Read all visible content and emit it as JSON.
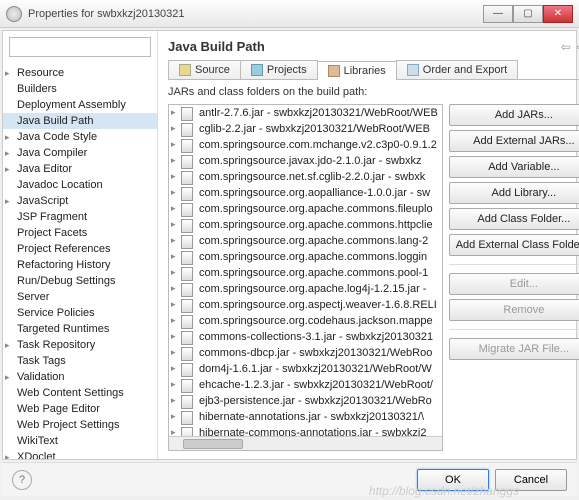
{
  "window": {
    "title": "Properties for swbxkzj20130321"
  },
  "sidebar": {
    "filter_placeholder": "",
    "items": [
      {
        "label": "Resource",
        "expandable": true
      },
      {
        "label": "Builders"
      },
      {
        "label": "Deployment Assembly"
      },
      {
        "label": "Java Build Path",
        "selected": true
      },
      {
        "label": "Java Code Style",
        "expandable": true
      },
      {
        "label": "Java Compiler",
        "expandable": true
      },
      {
        "label": "Java Editor",
        "expandable": true
      },
      {
        "label": "Javadoc Location"
      },
      {
        "label": "JavaScript",
        "expandable": true
      },
      {
        "label": "JSP Fragment"
      },
      {
        "label": "Project Facets"
      },
      {
        "label": "Project References"
      },
      {
        "label": "Refactoring History"
      },
      {
        "label": "Run/Debug Settings"
      },
      {
        "label": "Server"
      },
      {
        "label": "Service Policies"
      },
      {
        "label": "Targeted Runtimes"
      },
      {
        "label": "Task Repository",
        "expandable": true
      },
      {
        "label": "Task Tags"
      },
      {
        "label": "Validation",
        "expandable": true
      },
      {
        "label": "Web Content Settings"
      },
      {
        "label": "Web Page Editor"
      },
      {
        "label": "Web Project Settings"
      },
      {
        "label": "WikiText"
      },
      {
        "label": "XDoclet",
        "expandable": true
      }
    ]
  },
  "main": {
    "title": "Java Build Path",
    "tabs": [
      {
        "label": "Source"
      },
      {
        "label": "Projects"
      },
      {
        "label": "Libraries",
        "active": true
      },
      {
        "label": "Order and Export"
      }
    ],
    "description": "JARs and class folders on the build path:",
    "jars": [
      "antlr-2.7.6.jar - swbxkzj20130321/WebRoot/WEB",
      "cglib-2.2.jar - swbxkzj20130321/WebRoot/WEB",
      "com.springsource.com.mchange.v2.c3p0-0.9.1.2",
      "com.springsource.javax.jdo-2.1.0.jar - swbxkz",
      "com.springsource.net.sf.cglib-2.2.0.jar - swbxk",
      "com.springsource.org.aopalliance-1.0.0.jar - sw",
      "com.springsource.org.apache.commons.fileuplo",
      "com.springsource.org.apache.commons.httpclie",
      "com.springsource.org.apache.commons.lang-2",
      "com.springsource.org.apache.commons.loggin",
      "com.springsource.org.apache.commons.pool-1",
      "com.springsource.org.apache.log4j-1.2.15.jar -",
      "com.springsource.org.aspectj.weaver-1.6.8.RELI",
      "com.springsource.org.codehaus.jackson.mappe",
      "commons-collections-3.1.jar - swbxkzj20130321",
      "commons-dbcp.jar - swbxkzj20130321/WebRoo",
      "dom4j-1.6.1.jar - swbxkzj20130321/WebRoot/W",
      "ehcache-1.2.3.jar - swbxkzj20130321/WebRoot/",
      "ejb3-persistence.jar - swbxkzj20130321/WebRo",
      "hibernate-annotations.jar - swbxkzj20130321/\\",
      "hibernate-commons-annotations.jar - swbxkzj2"
    ],
    "buttons": [
      {
        "label": "Add JARs...",
        "enabled": true
      },
      {
        "label": "Add External JARs...",
        "enabled": true
      },
      {
        "label": "Add Variable...",
        "enabled": true
      },
      {
        "label": "Add Library...",
        "enabled": true
      },
      {
        "label": "Add Class Folder...",
        "enabled": true
      },
      {
        "label": "Add External Class Folder...",
        "enabled": true
      },
      {
        "label": "Edit...",
        "enabled": false
      },
      {
        "label": "Remove",
        "enabled": false
      },
      {
        "label": "Migrate JAR File...",
        "enabled": false
      }
    ]
  },
  "footer": {
    "ok": "OK",
    "cancel": "Cancel"
  },
  "watermark": "http://blog.csdn.net/zhanggs"
}
